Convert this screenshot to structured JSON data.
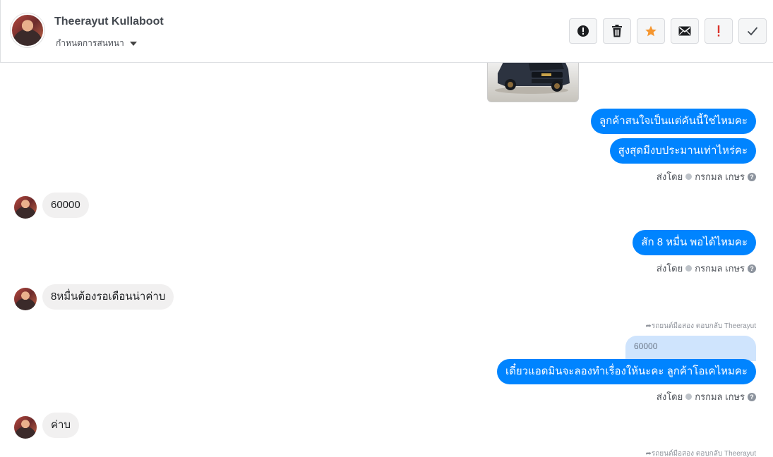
{
  "header": {
    "name": "Theerayut Kullaboot",
    "subtitle": "กำหนดการสนทนา"
  },
  "actions": [
    {
      "name": "report",
      "icon": "exclamation-circle-icon"
    },
    {
      "name": "delete",
      "icon": "trash-icon"
    },
    {
      "name": "star",
      "icon": "star-icon",
      "color": "#f5962f"
    },
    {
      "name": "mail",
      "icon": "envelope-icon"
    },
    {
      "name": "important",
      "icon": "exclamation-mark-icon",
      "color": "#d9342b"
    },
    {
      "name": "done",
      "icon": "checkmark-icon"
    }
  ],
  "messages": {
    "out1": "ลูกค้าสนใจเป็นแต่คันนี้ใช่ไหมคะ",
    "out2": "สูงสุดมีงบประมานเท่าไหร่คะ",
    "in1": "60000",
    "out3": "สัก 8 หมื่น พอได้ไหมคะ",
    "in2": "8หมื่นต้องรอเดือนน่าค่าบ",
    "reply_note": "รถยนต์มือสอง ตอบกลับ Theerayut",
    "quoted": "60000",
    "out4": "เดี๋ยวแอดมินจะลองทำเรื่องให้นะคะ ลูกค้าโอเคไหมคะ",
    "in3": "ค่าบ",
    "reply_note2": "รถยนต์มือสอง ตอบกลับ Theerayut"
  },
  "sent_by": {
    "label": "ส่งโดย",
    "agent": "กรกมล เกษร"
  },
  "colors": {
    "accent": "#0084ff",
    "incoming": "#f1f0f0",
    "quoted": "#cfe4fd"
  }
}
